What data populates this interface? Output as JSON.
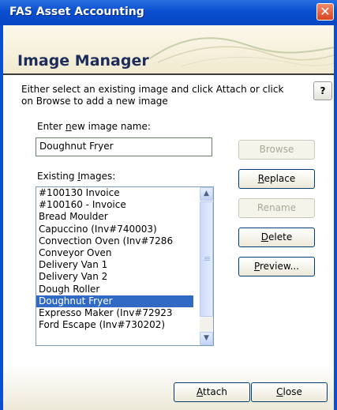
{
  "window": {
    "title": "FAS Asset Accounting",
    "close_glyph": "✕"
  },
  "header": {
    "title": "Image Manager"
  },
  "description": "Either select an existing image and click Attach or click on Browse to add a new image",
  "help_label": "?",
  "name_field": {
    "label": "Enter new image name:",
    "value": "Doughnut Fryer"
  },
  "existing": {
    "label": "Existing Images:",
    "items": [
      "#100130 Invoice",
      "#100160 - Invoice",
      "Bread Moulder",
      "Capuccino (Inv#740003)",
      "Convection Oven (Inv#7286",
      "Conveyor Oven",
      "Delivery Van 1",
      "Delivery Van 2",
      "Dough Roller",
      "Doughnut Fryer",
      "Expresso Maker (Inv#72923",
      "Ford Escape (Inv#730202)"
    ],
    "selected_index": 9
  },
  "buttons": {
    "browse": "Browse",
    "replace": "Replace",
    "rename": "Rename",
    "delete": "Delete",
    "preview": "Preview...",
    "attach": "Attach",
    "close": "Close"
  },
  "colors": {
    "titlebar": "#0a4fd0",
    "selection": "#316ac5",
    "banner_title": "#1d2d5a"
  }
}
